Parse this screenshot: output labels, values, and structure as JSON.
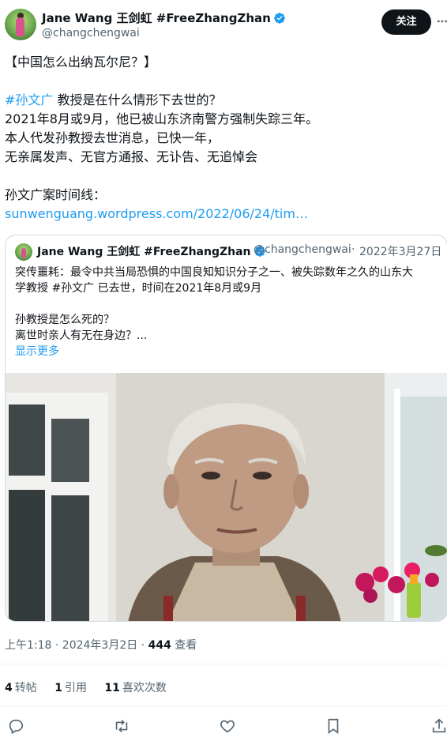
{
  "author": {
    "name": "Jane Wang 王剑虹 #FreeZhangZhan",
    "handle": "@changchengwai"
  },
  "follow_label": "关注",
  "tweet": {
    "line1": "【中国怎么出纳瓦尔尼？】",
    "hashtag": "#孙文广",
    "line2_rest": " 教授是在什么情形下去世的？",
    "line3": "2021年8月或9月，他已被山东济南警方强制失踪三年。",
    "line4": "本人代发孙教授去世消息，已快一年，",
    "line5": "无亲属发声、无官方通报、无讣告、无追悼会",
    "line6": "孙文广案时间线：",
    "link": "sunwenguang.wordpress.com/2022/06/24/tim…"
  },
  "quote": {
    "name": "Jane Wang 王剑虹 #FreeZhangZhan",
    "handle": "@changchengwai",
    "date": "2022年3月27日",
    "line1": "突传噩耗：最令中共当局恐惧的中国良知知识分子之一、被失踪数年之久的山东大",
    "line2": "学教授 #孙文广 已去世，时间在2021年8月或9月",
    "line3": "孙教授是怎么死的？",
    "line4": "离世时亲人有无在身边？...",
    "show_more": "显示更多"
  },
  "meta": {
    "time": "上午1:18 · 2024年3月2日 · ",
    "views": "444",
    "views_label": " 查看"
  },
  "stats": {
    "reposts": "4",
    "reposts_label": "转帖",
    "quotes": "1",
    "quotes_label": "引用",
    "likes": "11",
    "likes_label": "喜欢次数"
  },
  "colors": {
    "accent": "#1d9bf0",
    "text": "#0f1419",
    "muted": "#536471"
  },
  "icons": [
    "verified-badge-icon",
    "more-icon",
    "reply-icon",
    "repost-icon",
    "like-icon",
    "bookmark-icon",
    "share-icon"
  ]
}
